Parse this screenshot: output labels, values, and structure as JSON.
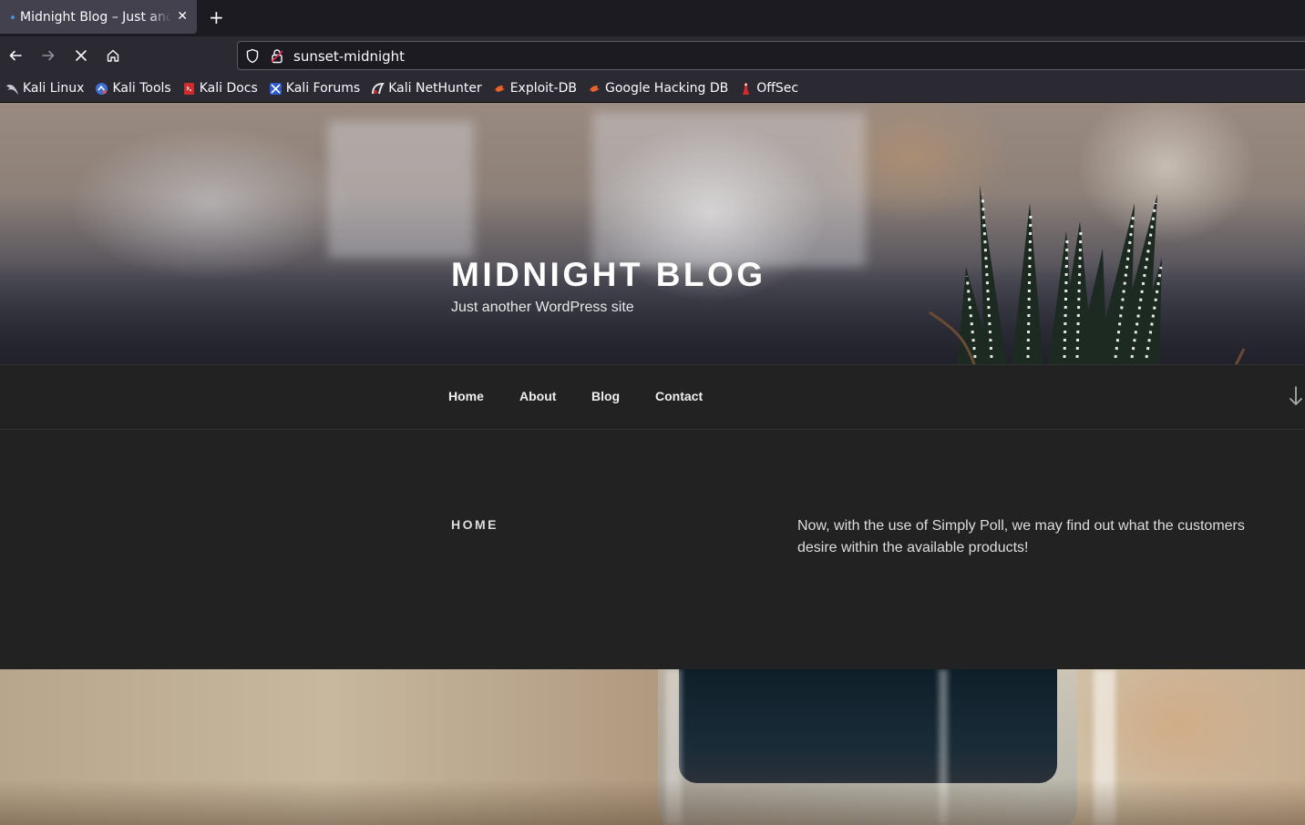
{
  "browser": {
    "tab": {
      "title": "Midnight Blog – Just another WordPress site"
    },
    "url": "sunset-midnight",
    "bookmarks": [
      {
        "label": "Kali Linux",
        "icon": "kali-dragon-icon"
      },
      {
        "label": "Kali Tools",
        "icon": "kali-tools-icon"
      },
      {
        "label": "Kali Docs",
        "icon": "kali-docs-icon"
      },
      {
        "label": "Kali Forums",
        "icon": "kali-forums-icon"
      },
      {
        "label": "Kali NetHunter",
        "icon": "nethunter-icon"
      },
      {
        "label": "Exploit-DB",
        "icon": "exploit-db-icon"
      },
      {
        "label": "Google Hacking DB",
        "icon": "ghdb-icon"
      },
      {
        "label": "OffSec",
        "icon": "offsec-icon"
      }
    ]
  },
  "site": {
    "title": "MIDNIGHT BLOG",
    "description": "Just another WordPress site",
    "menu": [
      "Home",
      "About",
      "Blog",
      "Contact"
    ],
    "page_heading": "HOME",
    "page_text": "Now, with the use of Simply Poll, we may find out what the customers desire within the available products!"
  },
  "colors": {
    "page_bg": "#222222",
    "chrome_bg": "#2b2a33",
    "tabbar_bg": "#1c1b22"
  }
}
